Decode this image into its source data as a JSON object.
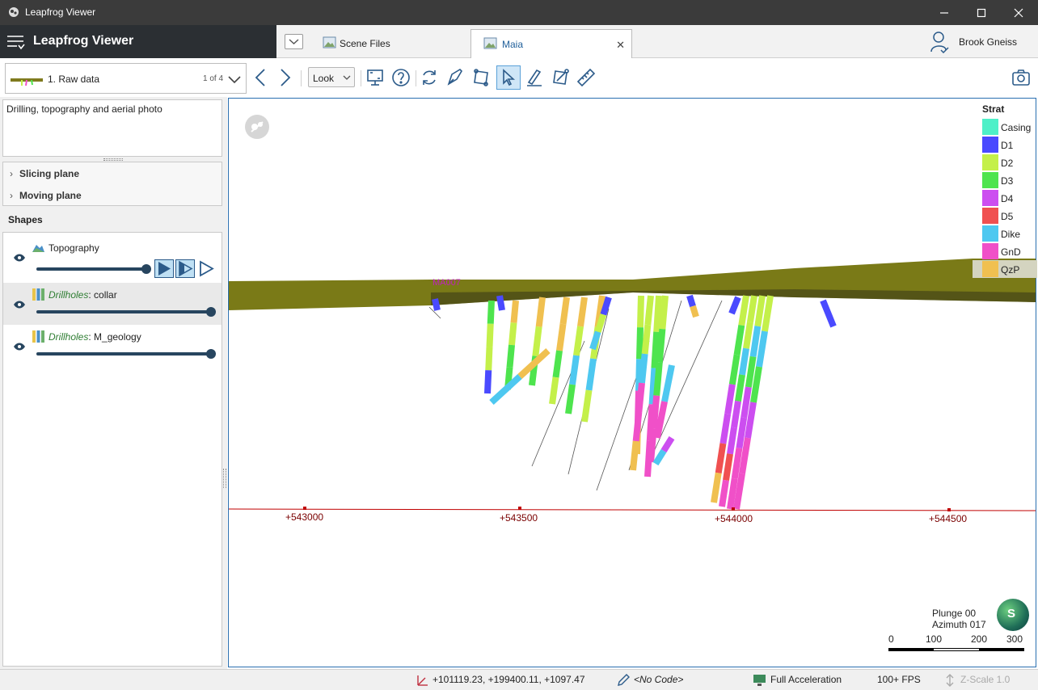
{
  "window": {
    "title": "Leapfrog Viewer"
  },
  "brand": {
    "name": "Leapfrog Viewer"
  },
  "tabs": [
    {
      "label": "Scene Files"
    },
    {
      "label": "Maia"
    }
  ],
  "user": {
    "name": "Brook Gneiss"
  },
  "toolbar": {
    "scene_name": "1. Raw data",
    "scene_count": "1 of 4",
    "look_label": "Look"
  },
  "left": {
    "description": "Drilling, topography and aerial photo",
    "slicing_plane": "Slicing plane",
    "moving_plane": "Moving plane",
    "shapes_heading": "Shapes",
    "shapes": [
      {
        "name": "Topography",
        "prefix": "",
        "selected": false,
        "slider": 1.0
      },
      {
        "name": ": collar",
        "prefix": "Drillholes",
        "selected": true,
        "slider": 1.0
      },
      {
        "name": ": M_geology",
        "prefix": "Drillholes",
        "selected": false,
        "slider": 1.0
      }
    ]
  },
  "legend": {
    "title": "Strat",
    "items": [
      {
        "label": "Casing",
        "color": "#4ef0c8"
      },
      {
        "label": "D1",
        "color": "#4a4aff"
      },
      {
        "label": "D2",
        "color": "#c4f04a"
      },
      {
        "label": "D3",
        "color": "#4ee44e"
      },
      {
        "label": "D4",
        "color": "#cc4ef0"
      },
      {
        "label": "D5",
        "color": "#f05050"
      },
      {
        "label": "Dike",
        "color": "#4ec8f0"
      },
      {
        "label": "GnD",
        "color": "#f050c8"
      },
      {
        "label": "QzP",
        "color": "#f0c050"
      }
    ]
  },
  "axis": {
    "ticks": [
      "+543000",
      "+543500",
      "+544000",
      "+544500"
    ]
  },
  "viewport": {
    "hole_labels": [
      "MA007"
    ],
    "plunge": "Plunge 00",
    "azimuth": "Azimuth 017",
    "compass": "S",
    "scale": [
      "0",
      "100",
      "200",
      "300"
    ]
  },
  "status": {
    "coords": "+101119.23, +199400.11, +1097.47",
    "code": "<No Code>",
    "accel": "Full Acceleration",
    "fps": "100+ FPS",
    "zscale": "Z-Scale 1.0"
  }
}
